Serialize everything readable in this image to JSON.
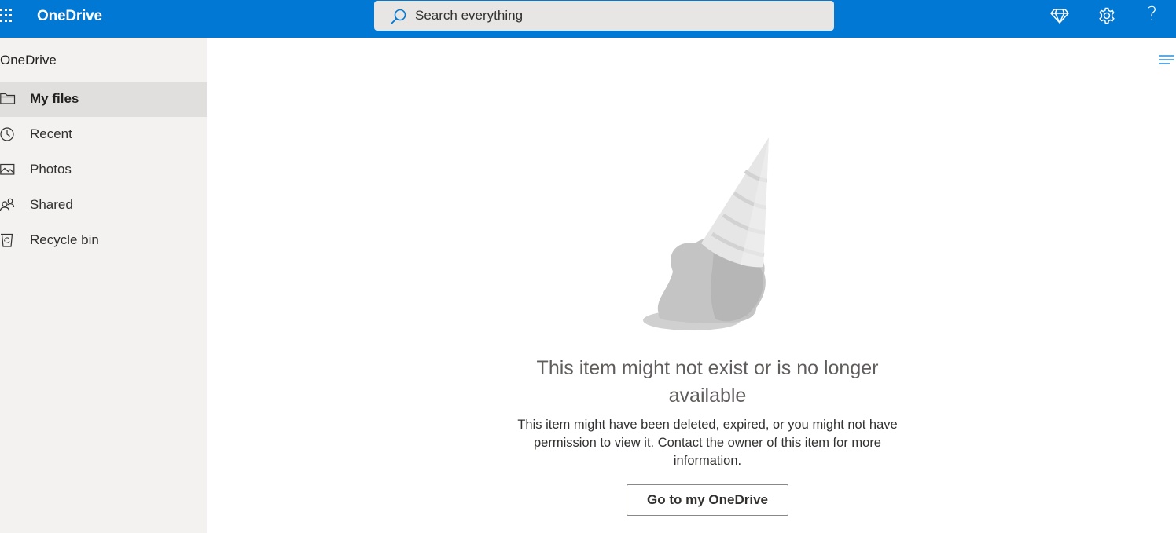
{
  "header": {
    "app_name": "OneDrive",
    "search_placeholder": "Search everything",
    "help_glyph": "?",
    "icons": [
      "app-launcher-icon",
      "search-icon",
      "premium-diamond-icon",
      "settings-gear-icon",
      "help-icon"
    ],
    "background_color": "#0078d4"
  },
  "sidebar": {
    "title": "OneDrive",
    "items": [
      {
        "label": "My files",
        "icon": "folder-icon",
        "active": true
      },
      {
        "label": "Recent",
        "icon": "clock-icon",
        "active": false
      },
      {
        "label": "Photos",
        "icon": "photo-icon",
        "active": false
      },
      {
        "label": "Shared",
        "icon": "people-icon",
        "active": false
      },
      {
        "label": "Recycle bin",
        "icon": "recycle-bin-icon",
        "active": false
      }
    ]
  },
  "main": {
    "view_options_icon": "view-options-icon",
    "illustration": "dropped-ice-cream-icon",
    "error_title": "This item might not exist or is no longer available",
    "error_message": "This item might have been deleted, expired, or you might not have permission to view it. Contact the owner of this item for more information.",
    "action_button_label": "Go to my OneDrive"
  }
}
